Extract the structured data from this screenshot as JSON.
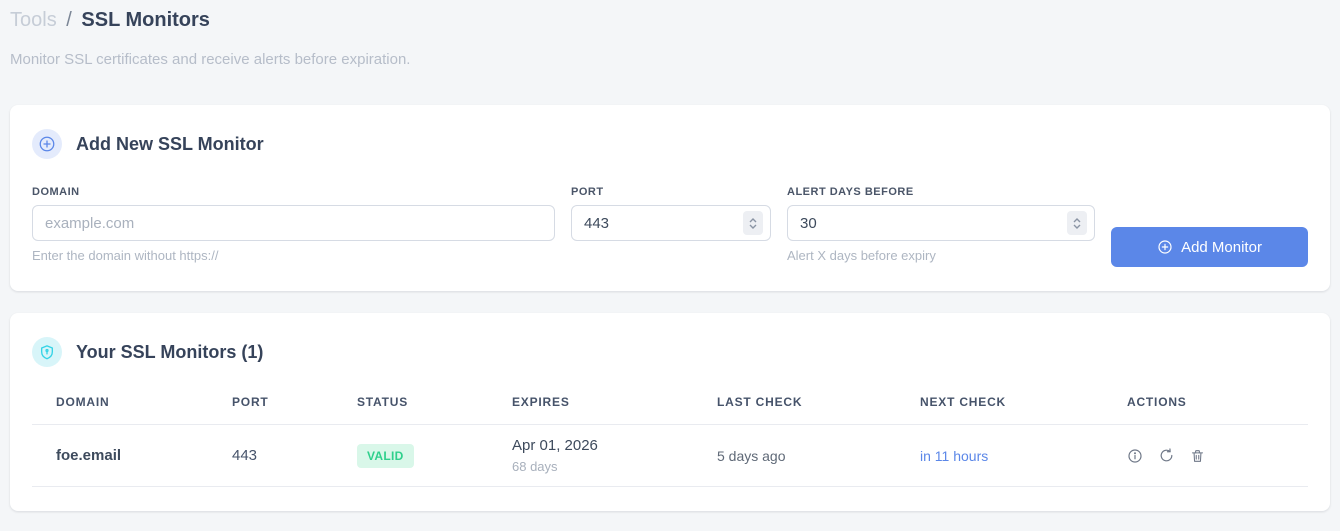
{
  "page": {
    "breadcrumb": {
      "section": "Tools",
      "separator": "/",
      "current": "SSL Monitors"
    },
    "subtitle": "Monitor SSL certificates and receive alerts before expiration."
  },
  "add_monitor_card": {
    "title": "Add New SSL Monitor",
    "fields": {
      "domain": {
        "label": "DOMAIN",
        "placeholder": "example.com",
        "helper": "Enter the domain without https://"
      },
      "port": {
        "label": "PORT",
        "value": "443"
      },
      "alert_days": {
        "label": "ALERT DAYS BEFORE",
        "value": "30",
        "helper": "Alert X days before expiry"
      }
    },
    "submit_label": "Add Monitor"
  },
  "monitors_card": {
    "title": "Your SSL Monitors (1)",
    "table": {
      "headers": [
        "DOMAIN",
        "PORT",
        "STATUS",
        "EXPIRES",
        "LAST CHECK",
        "NEXT CHECK",
        "ACTIONS"
      ],
      "rows": [
        {
          "domain": "foe.email",
          "port": "443",
          "status": "VALID",
          "expires_date": "Apr 01, 2026",
          "expires_days": "68 days",
          "last_check": "5 days ago",
          "next_check": "in 11 hours"
        }
      ]
    }
  },
  "colors": {
    "accent_blue": "#5b87e8",
    "valid_green_text": "#2fd08c",
    "valid_green_bg": "#d9f7e9",
    "shield_cyan": "#35d3e6",
    "page_background": "#f4f6f8"
  }
}
